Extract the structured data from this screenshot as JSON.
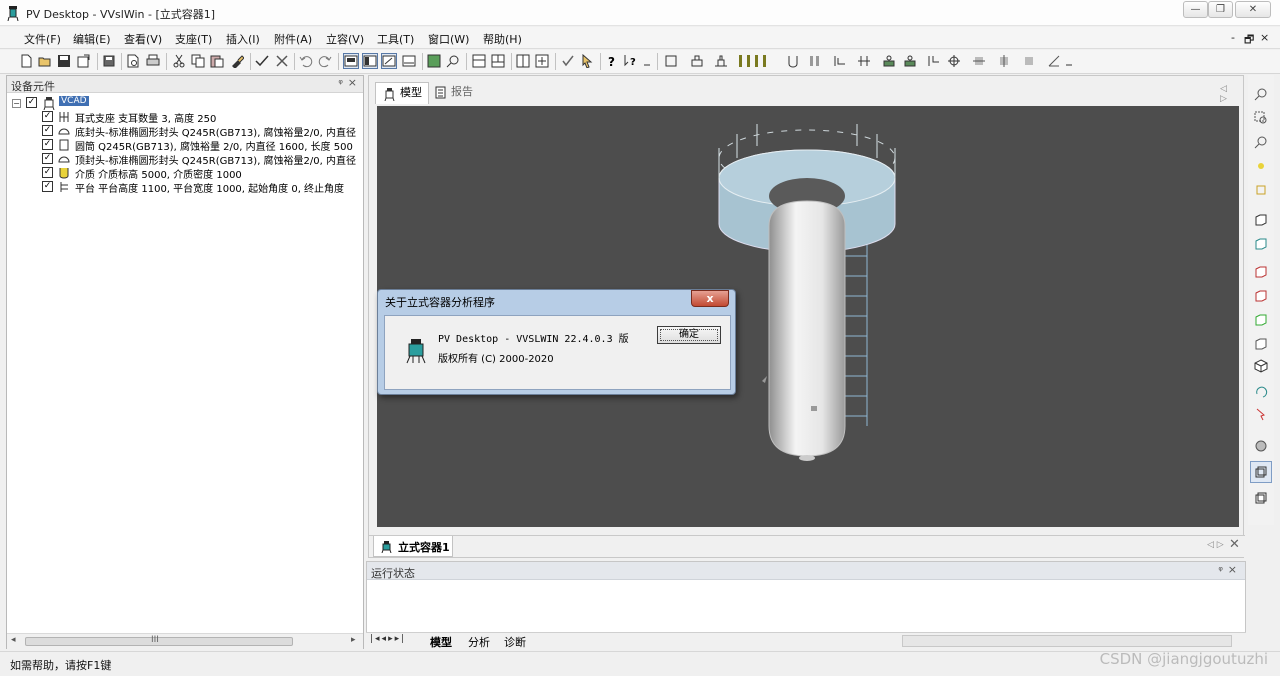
{
  "window": {
    "title": "PV Desktop - VVslWin - [立式容器1]",
    "buttons": {
      "minimize": "—",
      "restore": "❐",
      "close": "✕"
    }
  },
  "menubar": {
    "items": [
      "文件(F)",
      "编辑(E)",
      "查看(V)",
      "支座(T)",
      "插入(I)",
      "附件(A)",
      "立容(V)",
      "工具(T)",
      "窗口(W)",
      "帮助(H)"
    ],
    "mdi_buttons": {
      "minimize": "-",
      "restore": "🗗",
      "close": "×"
    }
  },
  "left_panel": {
    "title": "设备元件",
    "pin": "ᵠ",
    "close": "×",
    "root": {
      "expander": "−",
      "label": "VCAD"
    },
    "items": [
      {
        "text": "耳式支座 支耳数量 3, 高度 250",
        "icon": "support-icon"
      },
      {
        "text": "底封头-标准椭圆形封头 Q245R(GB713), 腐蚀裕量2/0, 内直径",
        "icon": "head-icon"
      },
      {
        "text": "圆筒 Q245R(GB713), 腐蚀裕量 2/0, 内直径 1600, 长度 500",
        "icon": "shell-icon"
      },
      {
        "text": "顶封头-标准椭圆形封头 Q245R(GB713), 腐蚀裕量2/0, 内直径",
        "icon": "head-icon"
      },
      {
        "text": "介质 介质标高 5000, 介质密度 1000",
        "icon": "medium-icon"
      },
      {
        "text": "平台 平台高度 1100, 平台宽度 1000, 起始角度 0, 终止角度",
        "icon": "platform-icon"
      }
    ],
    "scroll_label": "III"
  },
  "document": {
    "tabs": [
      {
        "label": "模型",
        "icon": "vessel-icon",
        "active": true
      },
      {
        "label": "报告",
        "icon": "report-icon",
        "active": false
      }
    ],
    "bottom_tab": {
      "label": "立式容器1"
    }
  },
  "dialog": {
    "title": "关于立式容器分析程序",
    "close": "x",
    "line1": "PV Desktop - VVSLWIN 22.4.0.3 版",
    "line2": "版权所有 (C) 2000-2020",
    "ok_label": "确定"
  },
  "output_panel": {
    "title": "运行状态",
    "pin": "ᵠ",
    "close": "×"
  },
  "sheet_tabs": [
    "模型",
    "分析",
    "诊断"
  ],
  "statusbar": {
    "text": "如需帮助，请按F1键",
    "watermark": "CSDN @jiangjgoutuzhi"
  },
  "colors": {
    "viewport_bg": "#4d4d4d",
    "platform_fill": "#a7c3d1",
    "dialog_frame": "#b7cde6",
    "selection": "#3f6fb3"
  }
}
